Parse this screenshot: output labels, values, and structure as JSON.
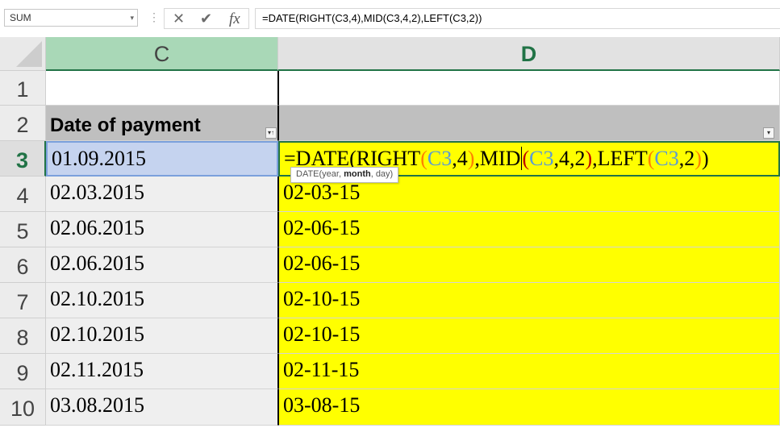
{
  "formula_bar": {
    "name_box": "SUM",
    "name_box_arrow": "▾",
    "separator": "⋮",
    "cancel_icon": "✕",
    "enter_icon": "✔",
    "fx_label": "fx",
    "formula": "=DATE(RIGHT(C3,4),MID(C3,4,2),LEFT(C3,2))"
  },
  "columns": [
    "C",
    "D"
  ],
  "rows": [
    {
      "num": "1",
      "c": "",
      "d": ""
    },
    {
      "num": "2",
      "c": "Date of payment",
      "d": ""
    },
    {
      "num": "3",
      "c": "01.09.2015",
      "d": "=DATE(RIGHT(C3,4),MID(C3,4,2),LEFT(C3,2))"
    },
    {
      "num": "4",
      "c": "02.03.2015",
      "d": "02-03-15"
    },
    {
      "num": "5",
      "c": "02.06.2015",
      "d": "02-06-15"
    },
    {
      "num": "6",
      "c": "02.06.2015",
      "d": "02-06-15"
    },
    {
      "num": "7",
      "c": "02.10.2015",
      "d": "02-10-15"
    },
    {
      "num": "8",
      "c": "02.10.2015",
      "d": "02-10-15"
    },
    {
      "num": "9",
      "c": "02.11.2015",
      "d": "02-11-15"
    },
    {
      "num": "10",
      "c": "03.08.2015",
      "d": "03-08-15"
    }
  ],
  "edit_tokens": {
    "t1": "=DATE(RIGHT",
    "t2": "(",
    "t3": "C3",
    "t4": ",4",
    "t5": ")",
    "t6": ",MID",
    "t7": "(",
    "t8": "C3",
    "t9": ",4,2",
    "t10": ")",
    "t11": ",LEFT",
    "t12": "(",
    "t13": "C3",
    "t14": ",2",
    "t15": ")",
    "t16": ")"
  },
  "tooltip": {
    "prefix": "DATE(year, ",
    "bold": "month",
    "suffix": ", day)"
  },
  "filter_icons": {
    "c2": "▾↑",
    "d2": "▾"
  },
  "colors": {
    "yellow_fill": "#ffff00",
    "header_green": "#217346",
    "selected_col_header": "#a9d8b7",
    "cell_ref": "#5b9bd5"
  }
}
